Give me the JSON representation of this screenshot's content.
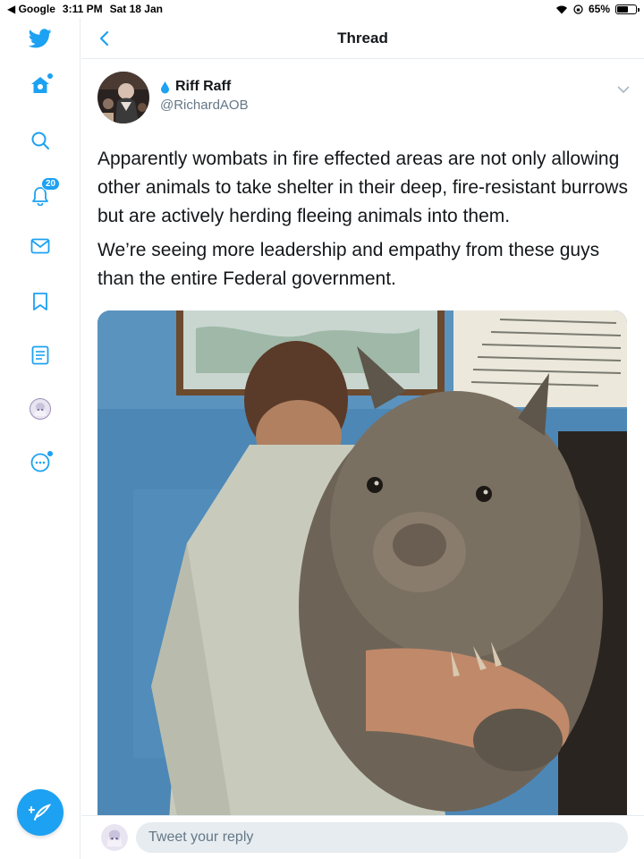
{
  "status_bar": {
    "back_app": "Google",
    "time": "3:11 PM",
    "date": "Sat 18 Jan",
    "battery": "65%",
    "battery_level": 0.65
  },
  "sidebar": {
    "items": [
      {
        "name": "home",
        "icon": "home-icon"
      },
      {
        "name": "explore",
        "icon": "search-icon"
      },
      {
        "name": "notifications",
        "icon": "bell-icon",
        "badge": "20"
      },
      {
        "name": "messages",
        "icon": "mail-icon"
      },
      {
        "name": "bookmarks",
        "icon": "bookmark-icon"
      },
      {
        "name": "lists",
        "icon": "list-icon"
      },
      {
        "name": "profile",
        "icon": "avatar"
      },
      {
        "name": "more",
        "icon": "more-icon"
      }
    ],
    "compose_icon": "compose-tweet-icon"
  },
  "header": {
    "title": "Thread"
  },
  "tweet": {
    "author_name": "Riff Raff",
    "author_handle": "@RichardAOB",
    "paragraphs": [
      "Apparently wombats in fire effected areas are not only allowing other animals to take shelter in their deep,  fire-resistant burrows but are actively herding fleeing animals into them.",
      "We’re seeing more leadership and empathy from these guys than the entire Federal government."
    ],
    "media_icon": "wombat-photo"
  },
  "reply": {
    "placeholder": "Tweet your reply"
  },
  "colors": {
    "accent": "#1da1f2",
    "text": "#14171a",
    "secondary": "#657786",
    "border": "#e6ecf0"
  }
}
